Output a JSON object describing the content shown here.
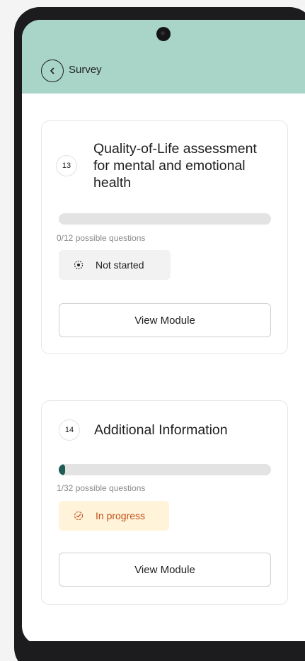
{
  "header": {
    "title": "Survey"
  },
  "modules": [
    {
      "number": "13",
      "title": "Quality-of-Life assessment for mental and emotional health",
      "progress_text": "0/12 possible questions",
      "progress_fraction": 0.0,
      "status": "Not started",
      "button_label": "View Module"
    },
    {
      "number": "14",
      "title": "Additional Information",
      "progress_text": "1/32 possible questions",
      "progress_fraction": 0.03125,
      "status": "In progress",
      "button_label": "View Module"
    }
  ],
  "colors": {
    "header_bg": "#a8d5c7",
    "progress_fill": "#1f5c55",
    "in_progress_text": "#c4501a",
    "in_progress_bg": "#fff3d9"
  }
}
